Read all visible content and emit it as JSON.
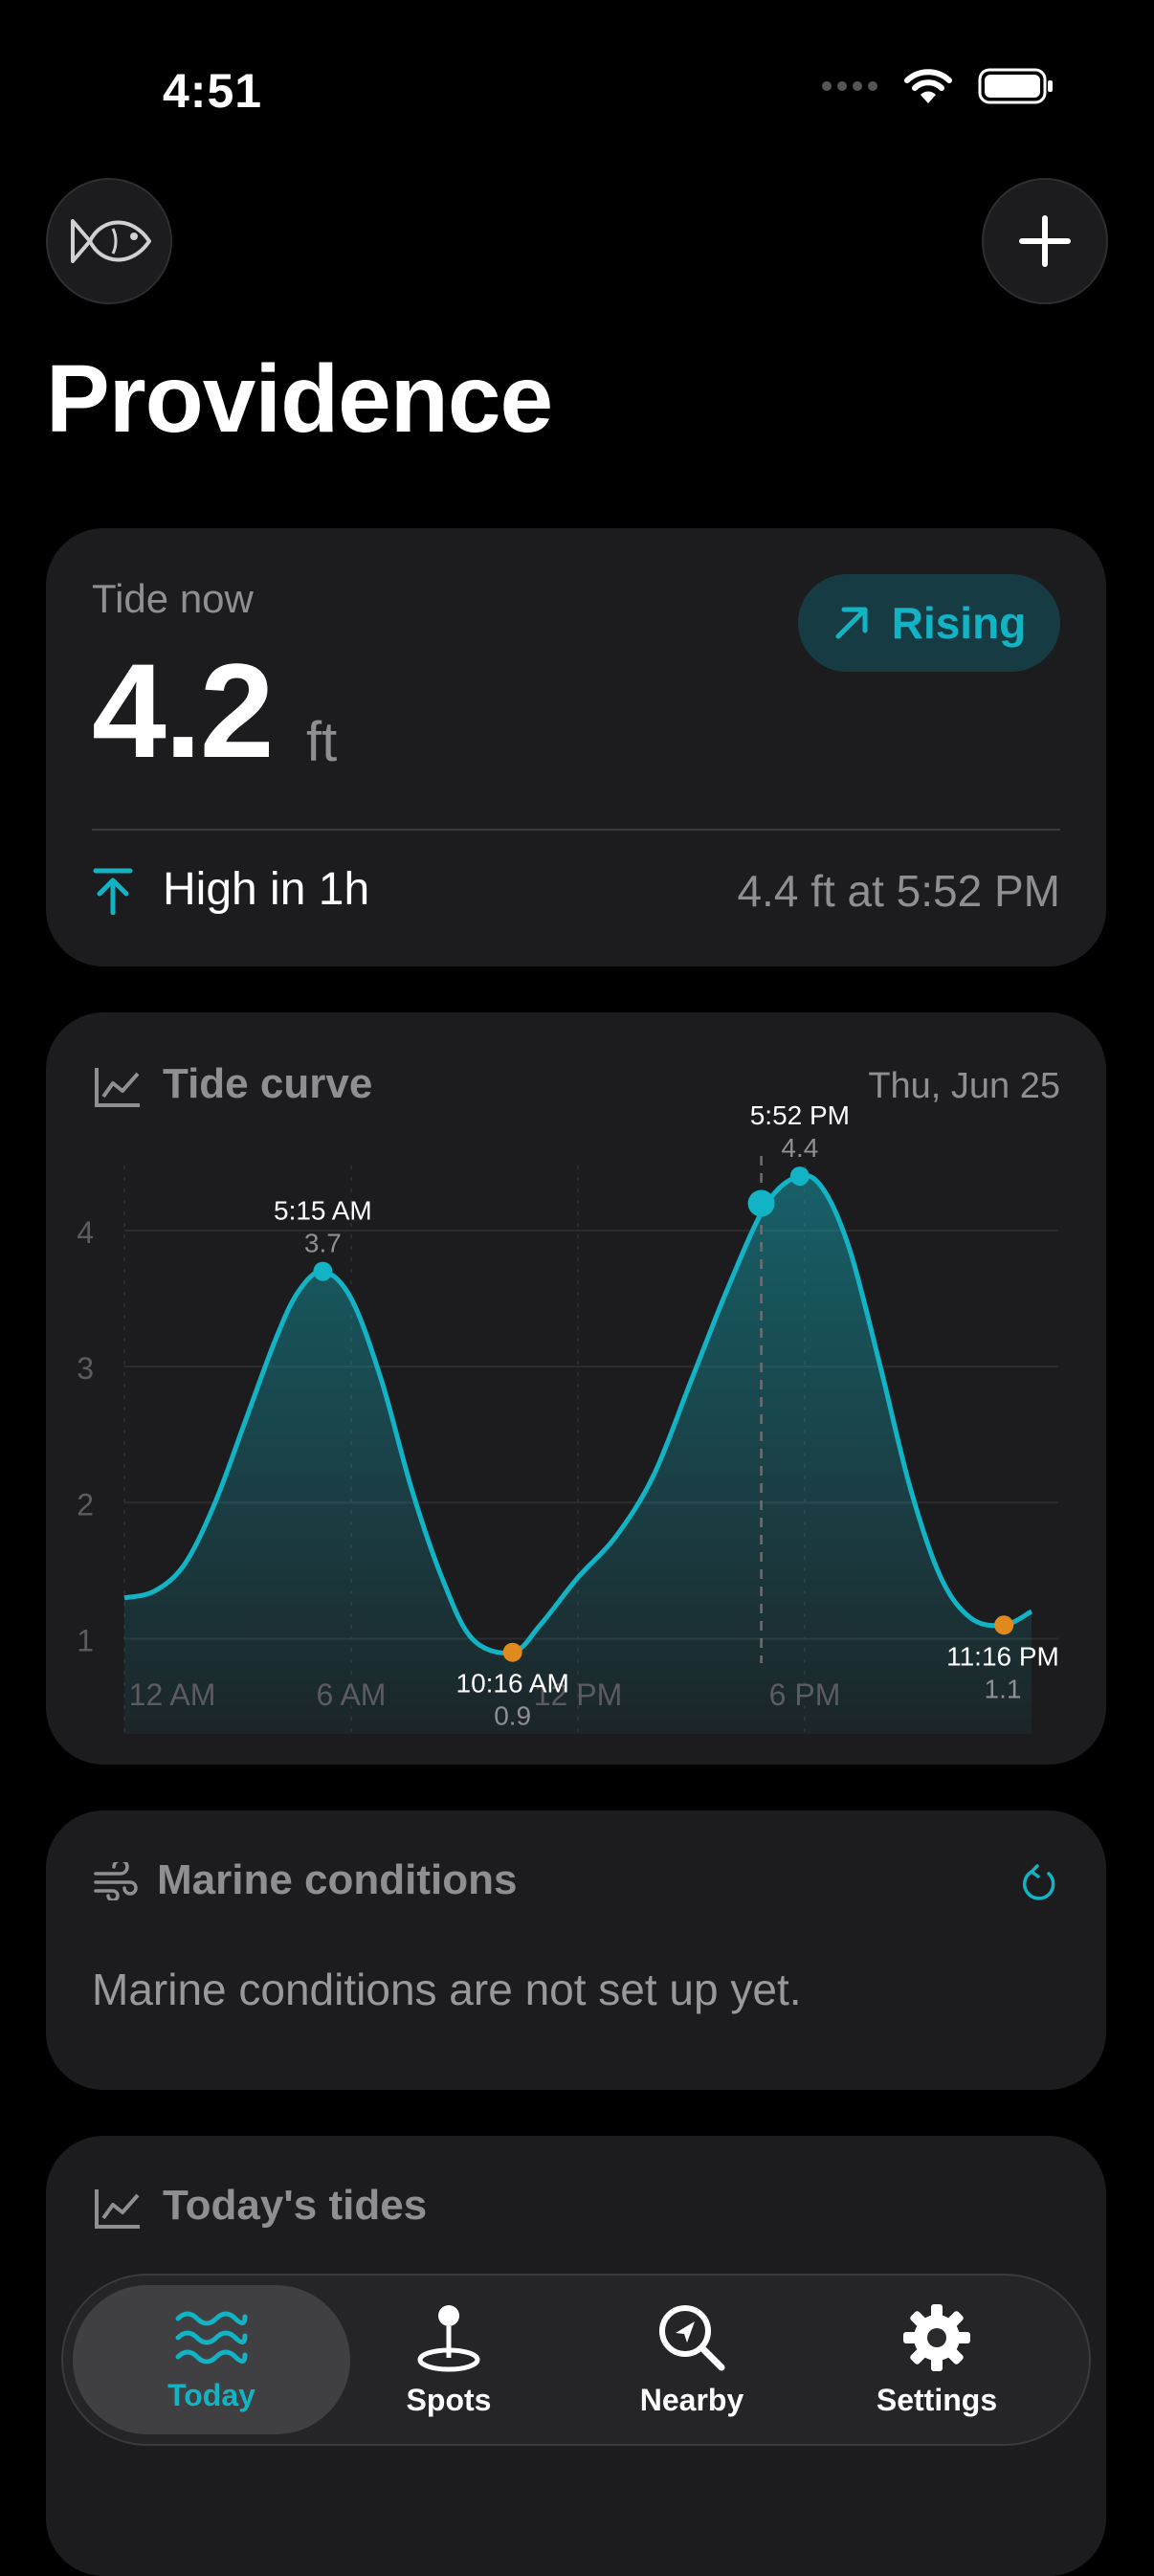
{
  "status_bar": {
    "time": "4:51"
  },
  "header": {
    "title": "Providence",
    "left_icon": "fish-icon",
    "right_icon": "plus-icon"
  },
  "tide_now": {
    "label": "Tide now",
    "value": "4.2",
    "unit": "ft",
    "trend": "Rising",
    "next_event": "High in 1h",
    "next_detail": "4.4 ft at 5:52 PM"
  },
  "tide_curve": {
    "title": "Tide curve",
    "date": "Thu, Jun 25"
  },
  "chart_data": {
    "type": "area",
    "title": "Tide curve",
    "x_ticks": [
      "12 AM",
      "6 AM",
      "12 PM",
      "6 PM"
    ],
    "y_ticks": [
      "1",
      "2",
      "3",
      "4"
    ],
    "ylim": [
      0.3,
      4.9
    ],
    "xlim_hours": [
      0,
      24
    ],
    "series": [
      {
        "x_hours": [
          0,
          0.8,
          1.6,
          2.4,
          3.2,
          4.0,
          4.6,
          5.25,
          6.0,
          6.8,
          7.6,
          8.4,
          9.2,
          10.27,
          11.0,
          12.0,
          13.0,
          14.0,
          15.0,
          16.0,
          17.0,
          17.87,
          18.5,
          19.2,
          20.0,
          20.8,
          21.6,
          22.4,
          23.27,
          24.0
        ],
        "y": [
          1.3,
          1.35,
          1.55,
          2.0,
          2.6,
          3.2,
          3.55,
          3.7,
          3.5,
          2.9,
          2.1,
          1.45,
          1.0,
          0.9,
          1.1,
          1.45,
          1.75,
          2.2,
          2.9,
          3.6,
          4.2,
          4.4,
          4.3,
          3.85,
          3.0,
          2.1,
          1.45,
          1.15,
          1.1,
          1.2
        ]
      }
    ],
    "extremes": [
      {
        "time": "5:15 AM",
        "value": "3.7",
        "x_hours": 5.25,
        "y": 3.7,
        "kind": "high"
      },
      {
        "time": "10:16 AM",
        "value": "0.9",
        "x_hours": 10.27,
        "y": 0.9,
        "kind": "low"
      },
      {
        "time": "5:52 PM",
        "value": "4.4",
        "x_hours": 17.87,
        "y": 4.4,
        "kind": "high"
      },
      {
        "time": "11:16 PM",
        "value": "1.1",
        "x_hours": 23.27,
        "y": 1.1,
        "kind": "low"
      }
    ],
    "now": {
      "x_hours": 16.85,
      "y": 4.2
    },
    "grid": true
  },
  "marine": {
    "title": "Marine conditions",
    "message": "Marine conditions are not set up yet."
  },
  "todays_tides": {
    "title": "Today's tides"
  },
  "tabbar": {
    "items": [
      {
        "label": "Today",
        "icon": "waves-icon"
      },
      {
        "label": "Spots",
        "icon": "map-pin-icon"
      },
      {
        "label": "Nearby",
        "icon": "location-search-icon"
      },
      {
        "label": "Settings",
        "icon": "gear-icon"
      }
    ]
  },
  "colors": {
    "accent": "#12b3c4",
    "low": "#e08a1e",
    "card": "#1c1c1e"
  }
}
